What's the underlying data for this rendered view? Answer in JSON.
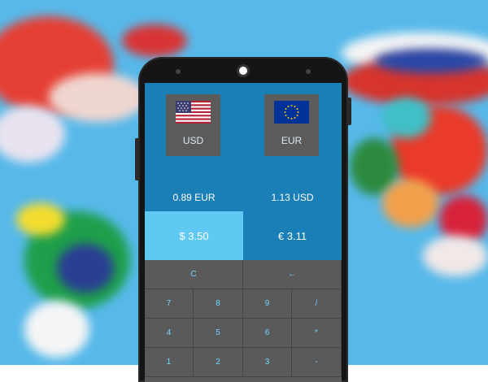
{
  "colors": {
    "accent": "#1a7fb6",
    "highlight": "#5fc9f3",
    "keypad": "#5a5a5a",
    "key_text": "#6fd7ff"
  },
  "currencies": [
    {
      "code": "USD",
      "flag": "us-flag-icon"
    },
    {
      "code": "EUR",
      "flag": "eu-flag-icon"
    }
  ],
  "rates": {
    "left": "0.89  EUR",
    "right": "1.13  USD"
  },
  "amounts": {
    "left": "$ 3.50",
    "right": "€ 3.11"
  },
  "keys": {
    "row1": [
      "C",
      "←"
    ],
    "row2": [
      "7",
      "8",
      "9",
      "/"
    ],
    "row3": [
      "4",
      "5",
      "6",
      "*"
    ],
    "row4": [
      "1",
      "2",
      "3",
      "-"
    ]
  }
}
